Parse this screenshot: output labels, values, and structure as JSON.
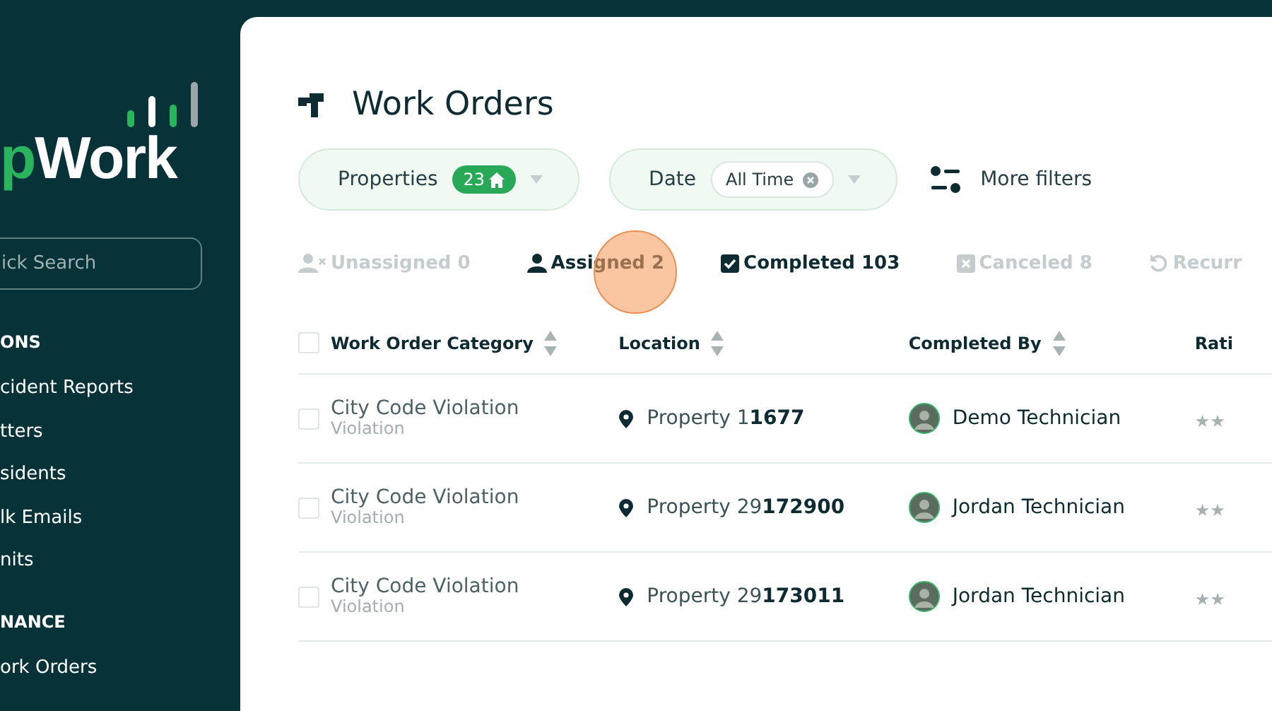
{
  "sidebar": {
    "logo": {
      "accent": "p",
      "text": "Work"
    },
    "search": {
      "placeholder": "ick Search"
    },
    "sections": [
      {
        "title": "ONS",
        "items": [
          {
            "label": "cident Reports"
          },
          {
            "label": "tters"
          },
          {
            "label": "sidents"
          },
          {
            "label": "lk Emails"
          },
          {
            "label": "nits"
          }
        ]
      },
      {
        "title": "NANCE",
        "items": [
          {
            "label": "ork Orders"
          }
        ]
      }
    ]
  },
  "page": {
    "title": "Work Orders",
    "filters": [
      {
        "kind": "count",
        "label": "Properties",
        "badge": "23"
      },
      {
        "kind": "chip",
        "label": "Date",
        "chip": "All Time"
      }
    ],
    "more_filters": "More filters",
    "status_tabs": [
      {
        "kind": "unassigned",
        "label": "Unassigned 0",
        "active": false
      },
      {
        "kind": "assigned",
        "label": "Assigned 2",
        "active": true
      },
      {
        "kind": "completed",
        "label": "Completed 103",
        "active": true
      },
      {
        "kind": "canceled",
        "label": "Canceled 8",
        "active": false
      },
      {
        "kind": "recurring",
        "label": "Recurr",
        "active": false
      }
    ],
    "table": {
      "select_all_checked": false,
      "columns": [
        "Work Order Category",
        "Location",
        "Completed By",
        "Rati"
      ],
      "rows": [
        {
          "checked": false,
          "category": "City Code Violation",
          "subcategory": "Violation",
          "location": "Property 1**1677**",
          "completed_by": "Demo Technician",
          "rating": "★★"
        },
        {
          "checked": false,
          "category": "City Code Violation",
          "subcategory": "Violation",
          "location": "Property 29**172900**",
          "completed_by": "Jordan Technician",
          "rating": "★★"
        },
        {
          "checked": false,
          "category": "City Code Violation",
          "subcategory": "Violation",
          "location": "Property 29**173011**",
          "completed_by": "Jordan Technician",
          "rating": "★★"
        }
      ]
    }
  }
}
